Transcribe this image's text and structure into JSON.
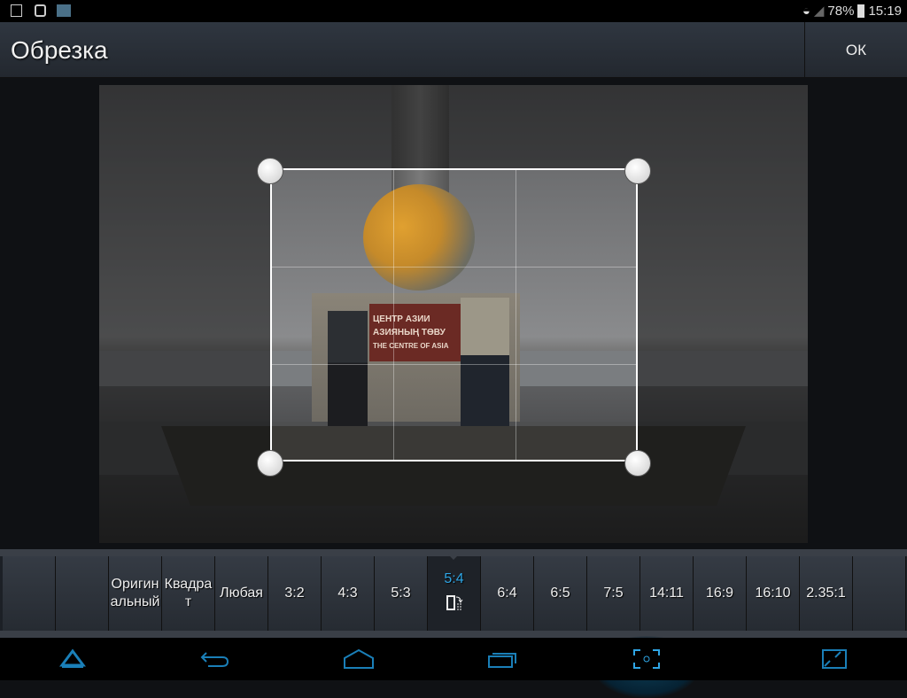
{
  "status": {
    "battery": "78%",
    "time": "15:19"
  },
  "header": {
    "title": "Обрезка",
    "ok_label": "ОК"
  },
  "photo": {
    "sign": [
      "ЦЕНТР АЗИИ",
      "АЗИЯНЫҢ ТӨВУ",
      "THE CENTRE OF ASIA"
    ]
  },
  "ratios": [
    {
      "label": ""
    },
    {
      "label": ""
    },
    {
      "label": "Оригинальный"
    },
    {
      "label": "Квадрат"
    },
    {
      "label": "Любая"
    },
    {
      "label": "3:2"
    },
    {
      "label": "4:3"
    },
    {
      "label": "5:3"
    },
    {
      "label": "5:4",
      "selected": true
    },
    {
      "label": "6:4"
    },
    {
      "label": "6:5"
    },
    {
      "label": "7:5"
    },
    {
      "label": "14:11"
    },
    {
      "label": "16:9"
    },
    {
      "label": "16:10"
    },
    {
      "label": "2.35:1"
    },
    {
      "label": ""
    }
  ],
  "colors": {
    "accent": "#2fa6e6",
    "nav": "#1a7fb8"
  }
}
